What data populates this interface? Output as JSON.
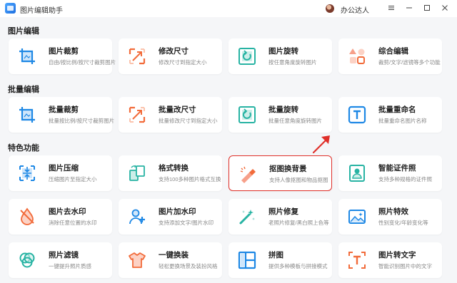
{
  "app": {
    "title": "图片编辑助手",
    "user_name": "办公达人"
  },
  "window_controls": [
    "menu-icon",
    "minimize-icon",
    "maximize-icon",
    "close-icon"
  ],
  "sections": [
    {
      "title": "图片编辑",
      "items": [
        {
          "title": "图片裁剪",
          "desc": "自由/按比例/按尺寸裁剪图片",
          "icon": "crop-icon"
        },
        {
          "title": "修改尺寸",
          "desc": "修改尺寸到指定大小",
          "icon": "resize-icon"
        },
        {
          "title": "图片旋转",
          "desc": "按任意角度旋转图片",
          "icon": "rotate-icon"
        },
        {
          "title": "综合编辑",
          "desc": "裁剪/文字/滤镜等多个功能",
          "icon": "shapes-icon"
        }
      ]
    },
    {
      "title": "批量编辑",
      "items": [
        {
          "title": "批量裁剪",
          "desc": "批量按比例/按尺寸裁剪图片",
          "icon": "crop-icon"
        },
        {
          "title": "批量改尺寸",
          "desc": "批量修改尺寸到指定大小",
          "icon": "resize-icon"
        },
        {
          "title": "批量旋转",
          "desc": "批量任意角度旋转图片",
          "icon": "rotate-icon"
        },
        {
          "title": "批量重命名",
          "desc": "批量重命名图片名称",
          "icon": "text-icon"
        }
      ]
    },
    {
      "title": "特色功能",
      "items": [
        {
          "title": "图片压缩",
          "desc": "压缩图片至指定大小",
          "icon": "compress-icon"
        },
        {
          "title": "格式转换",
          "desc": "支持100多种图片格式互换",
          "icon": "convert-icon"
        },
        {
          "title": "抠图换背景",
          "desc": "支持人像抠图和物品抠图",
          "icon": "eraser-icon",
          "highlighted": true
        },
        {
          "title": "智能证件照",
          "desc": "支持多种规格的证件照",
          "icon": "id-photo-icon"
        },
        {
          "title": "图片去水印",
          "desc": "消除任意位置的水印",
          "icon": "drop-icon"
        },
        {
          "title": "图片加水印",
          "desc": "支持添加文字/图片水印",
          "icon": "add-person-icon"
        },
        {
          "title": "照片修复",
          "desc": "老照片修复/黑白照上色等",
          "icon": "magic-wand-icon"
        },
        {
          "title": "照片特效",
          "desc": "性别变化/年龄变化等",
          "icon": "image-effect-icon"
        },
        {
          "title": "照片滤镜",
          "desc": "一键提升照片质感",
          "icon": "filter-icon"
        },
        {
          "title": "一键换装",
          "desc": "轻松更换场景及装扮风格",
          "icon": "shirt-icon"
        },
        {
          "title": "拼图",
          "desc": "提供多种模板与拼接模式",
          "icon": "collage-icon"
        },
        {
          "title": "图片转文字",
          "desc": "智能识别图片中的文字",
          "icon": "ocr-icon"
        }
      ]
    }
  ],
  "colors": {
    "accent_blue": "#1e88e5",
    "accent_orange": "#f26b3a",
    "accent_green": "#27b3a3",
    "highlight_red": "#e0302a"
  }
}
